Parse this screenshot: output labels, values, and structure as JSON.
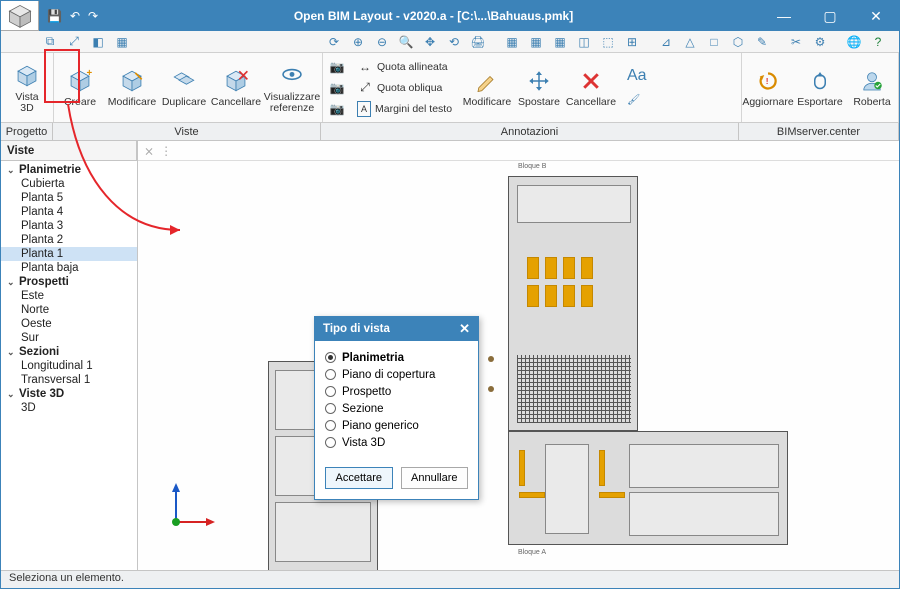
{
  "app": {
    "title": "Open BIM Layout - v2020.a - [C:\\...\\Bahuaus.pmk]"
  },
  "ribbon": {
    "groups": [
      {
        "key": "progetto",
        "label": "Progetto",
        "buttons": [
          {
            "key": "vista3d",
            "label": "Vista\n3D"
          }
        ]
      },
      {
        "key": "viste",
        "label": "Viste",
        "buttons": [
          {
            "key": "creare",
            "label": "Creare"
          },
          {
            "key": "modificare",
            "label": "Modificare"
          },
          {
            "key": "duplicare",
            "label": "Duplicare"
          },
          {
            "key": "cancellare",
            "label": "Cancellare"
          },
          {
            "key": "visualizzare",
            "label": "Visualizzare\nreferenze"
          }
        ]
      },
      {
        "key": "annotazioni",
        "label": "Annotazioni",
        "camera_stack": true,
        "quota_stack": [
          {
            "key": "quota_allineata",
            "label": "Quota allineata"
          },
          {
            "key": "quota_obliqua",
            "label": "Quota obliqua"
          },
          {
            "key": "margini",
            "label": "Margini del testo"
          }
        ],
        "buttons2": [
          {
            "key": "anno_modificare",
            "label": "Modificare"
          },
          {
            "key": "anno_spostare",
            "label": "Spostare"
          },
          {
            "key": "anno_cancellare",
            "label": "Cancellare"
          }
        ]
      },
      {
        "key": "bimserver",
        "label": "BIMserver.center",
        "buttons": [
          {
            "key": "aggiornare",
            "label": "Aggiornare"
          },
          {
            "key": "esportare",
            "label": "Esportare"
          },
          {
            "key": "user",
            "label": "Roberta"
          }
        ]
      }
    ]
  },
  "sidebar": {
    "header": "Viste",
    "groups": [
      {
        "name": "Planimetrie",
        "items": [
          "Cubierta",
          "Planta 5",
          "Planta 4",
          "Planta 3",
          "Planta 2",
          "Planta 1",
          "Planta baja"
        ],
        "selected": "Planta 1"
      },
      {
        "name": "Prospetti",
        "items": [
          "Este",
          "Norte",
          "Oeste",
          "Sur"
        ]
      },
      {
        "name": "Sezioni",
        "items": [
          "Longitudinal 1",
          "Transversal 1"
        ]
      },
      {
        "name": "Viste 3D",
        "items": [
          "3D"
        ]
      }
    ]
  },
  "dialog": {
    "title": "Tipo di vista",
    "options": [
      "Planimetria",
      "Piano di copertura",
      "Prospetto",
      "Sezione",
      "Piano generico",
      "Vista 3D"
    ],
    "selected": "Planimetria",
    "accept": "Accettare",
    "cancel": "Annullare"
  },
  "status": "Seleziona un elemento.",
  "colors": {
    "brand": "#3c83b9",
    "highlight": "#e5262b"
  }
}
